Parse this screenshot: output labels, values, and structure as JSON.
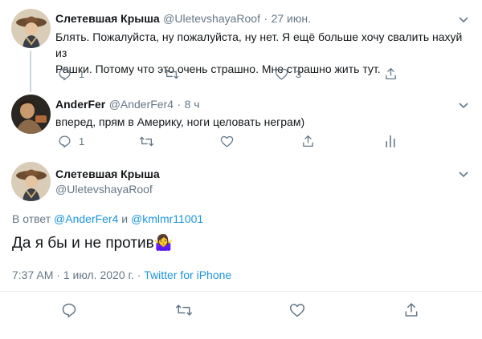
{
  "tweet1": {
    "name": "Слетевшая Крыша",
    "handle": "@UletevshayaRoof",
    "sep": "·",
    "time": "27 июн.",
    "text_line1": "Блять. Пожалуйста, ну пожалуйста, ну нет. Я ещё больше хочу свалить нахуй из",
    "text_line2": "Рашки. Потому что это очень страшно. Мне страшно жить тут.",
    "reply_count": "1",
    "like_count": "3"
  },
  "tweet2": {
    "name": "AnderFer",
    "handle": "@AnderFer4",
    "sep": "·",
    "time": "8 ч",
    "text": "вперед, прям в Америку, ноги целовать неграм)",
    "reply_count": "1"
  },
  "main_tweet": {
    "name": "Слетевшая Крыша",
    "handle": "@UletevshayaRoof",
    "reply_prefix": "В ответ",
    "reply_user1": "@AnderFer4",
    "reply_and": "и",
    "reply_user2": "@kmlmr11001",
    "text": "Да я бы и не против",
    "emoji": "🤷‍♀️",
    "time": "7:37 AM",
    "date": "1 июл. 2020 г.",
    "sep": "·",
    "source": "Twitter for iPhone"
  },
  "icons": [
    "reply-icon",
    "retweet-icon",
    "like-icon",
    "share-icon",
    "analytics-icon",
    "chevron-down-icon"
  ],
  "colors": {
    "link": "#1b95e0",
    "muted": "#657786",
    "text": "#14171a",
    "line": "#ccd6dd"
  }
}
